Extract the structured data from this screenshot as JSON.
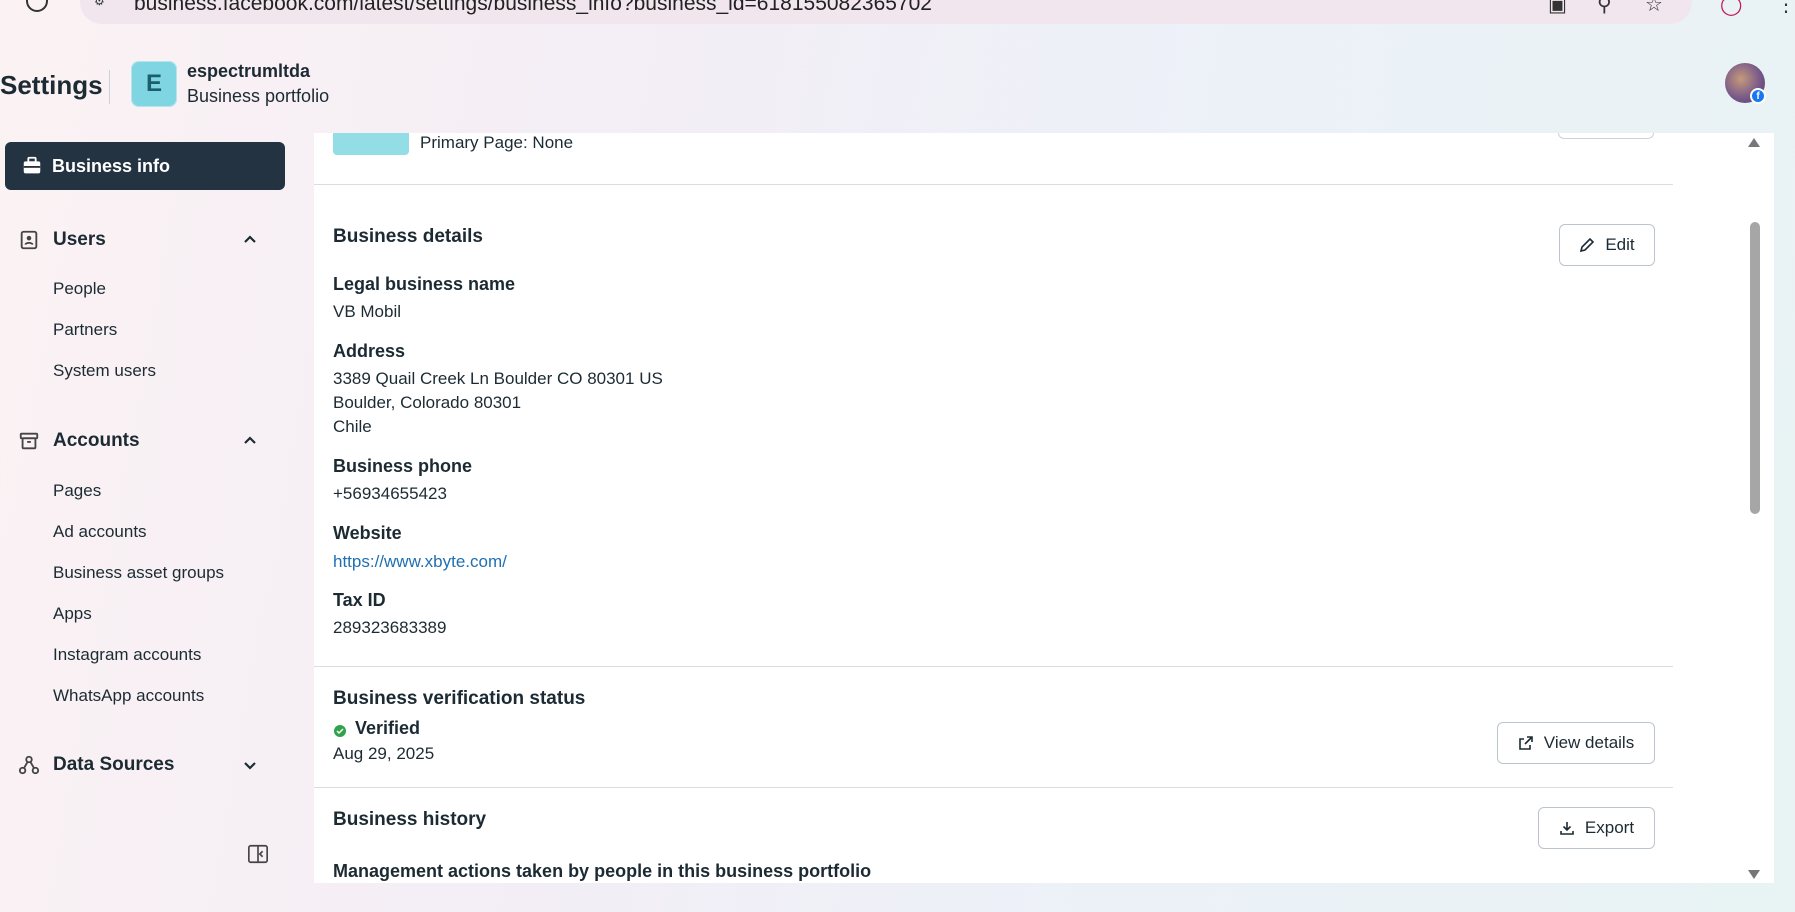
{
  "browser": {
    "url": "business.facebook.com/latest/settings/business_info?business_id=618155082365702"
  },
  "header": {
    "title": "Settings",
    "business_initial": "E",
    "business_name": "espectrumltda",
    "business_subtitle": "Business portfolio"
  },
  "sidebar": {
    "active_item": "Business info",
    "users": {
      "label": "Users",
      "items": [
        "People",
        "Partners",
        "System users"
      ]
    },
    "accounts": {
      "label": "Accounts",
      "items": [
        "Pages",
        "Ad accounts",
        "Business asset groups",
        "Apps",
        "Instagram accounts",
        "WhatsApp accounts"
      ]
    },
    "data_sources": {
      "label": "Data Sources"
    }
  },
  "main": {
    "primary_page": "Primary Page: None",
    "business_details": {
      "title": "Business details",
      "edit_label": "Edit",
      "legal_name_label": "Legal business name",
      "legal_name": "VB Mobil",
      "address_label": "Address",
      "address_line1": "3389 Quail Creek Ln Boulder CO 80301 US",
      "address_line2": "Boulder, Colorado 80301",
      "address_line3": "Chile",
      "phone_label": "Business phone",
      "phone": "+56934655423",
      "website_label": "Website",
      "website": "https://www.xbyte.com/",
      "tax_label": "Tax ID",
      "tax_id": "289323683389"
    },
    "verification": {
      "title": "Business verification status",
      "status": "Verified",
      "date": "Aug 29, 2025",
      "view_label": "View details"
    },
    "history": {
      "title": "Business history",
      "export_label": "Export",
      "subtitle": "Management actions taken by people in this business portfolio"
    }
  },
  "colors": {
    "sidebar_active_bg": "#233341",
    "link": "#1f6fb2",
    "verified": "#31a24c",
    "avatar_bg": "#7fd6e2"
  }
}
